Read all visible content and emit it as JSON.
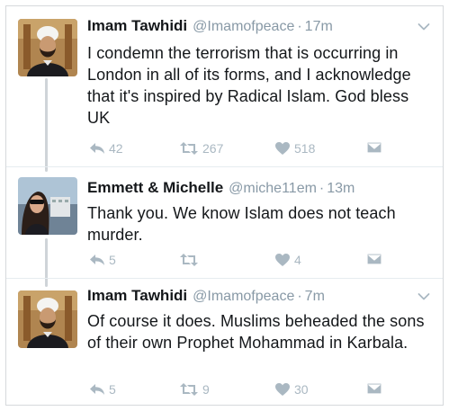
{
  "tweets": [
    {
      "name": "Imam Tawhidi",
      "handle": "@Imamofpeace",
      "separator": "·",
      "time": "17m",
      "text": "I condemn the terrorism that is occurring in London in all of its forms, and I acknowledge that it's inspired by Radical Islam. God bless UK",
      "replies": "42",
      "retweets": "267",
      "likes": "518"
    },
    {
      "name": "Emmett & Michelle",
      "handle": "@miche11em",
      "separator": "·",
      "time": "13m",
      "text": "Thank you. We know Islam does not teach murder.",
      "replies": "5",
      "retweets": "",
      "likes": "4"
    },
    {
      "name": "Imam Tawhidi",
      "handle": "@Imamofpeace",
      "separator": "·",
      "time": "7m",
      "text": "Of course it does. Muslims beheaded the sons of their own Prophet Mohammad in Karbala.",
      "replies": "5",
      "retweets": "9",
      "likes": "30"
    }
  ],
  "icons": {
    "reply": "reply-icon",
    "retweet": "retweet-icon",
    "like": "heart-icon",
    "message": "envelope-icon",
    "more": "chevron-down-icon"
  },
  "colors": {
    "icon_gray": "#aab8c2",
    "handle_gray": "#8899a6",
    "thread_line": "#cfd4d8",
    "text": "#14171a"
  }
}
